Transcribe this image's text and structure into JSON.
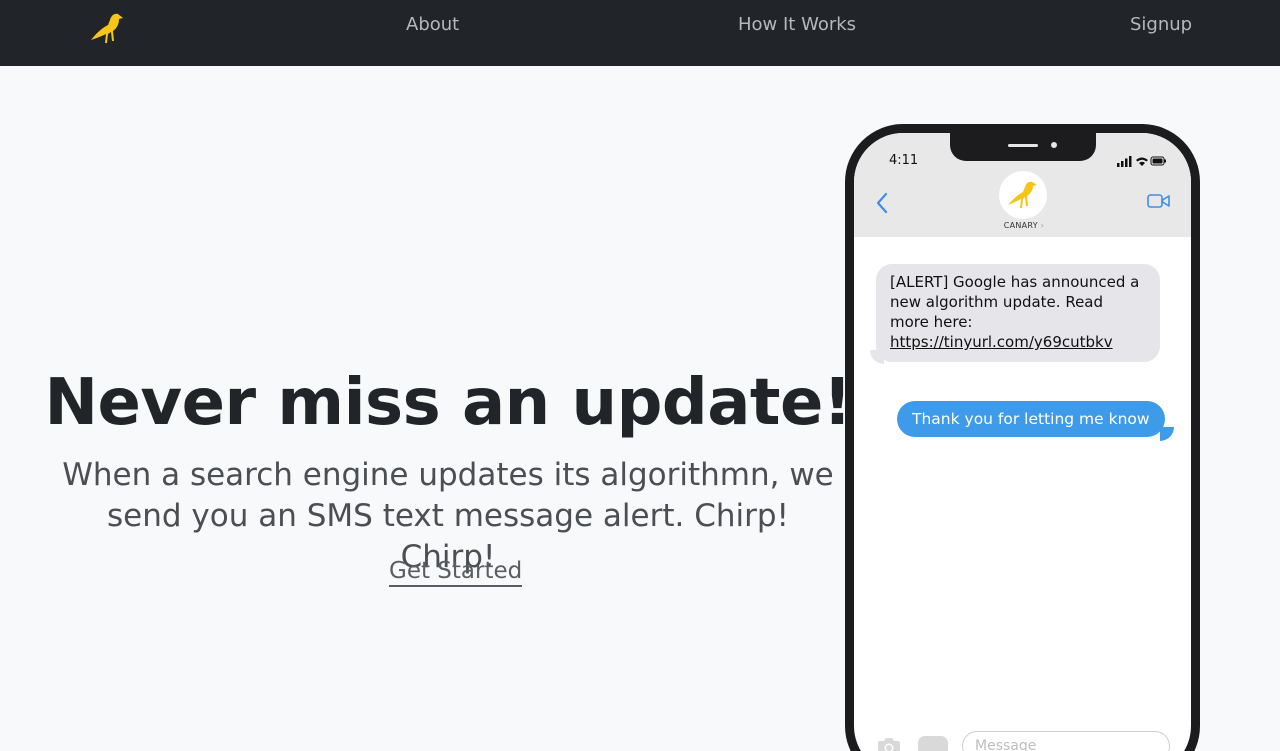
{
  "nav": {
    "logo_icon": "canary-bird-icon",
    "about": "About",
    "how_it_works": "How It Works",
    "signup": "Signup"
  },
  "hero": {
    "title": "Never miss an update!",
    "subtitle_line1": "When a search engine updates its algorithmn, we",
    "subtitle_line2": "send you an SMS text message alert. Chirp! Chirp!",
    "cta": "Get Started"
  },
  "phone": {
    "time": "4:11",
    "contact_name": "CANARY",
    "incoming_text": "[ALERT] Google has announced a new algorithm update. Read more here:",
    "incoming_link": "https://tinyurl.com/y69cutbkv",
    "outgoing_text": "Thank you for letting me know",
    "message_placeholder": "Message"
  },
  "colors": {
    "nav_bg": "#212529",
    "page_bg": "#f8f9fa",
    "brand_yellow": "#f5c518",
    "bubble_out": "#3d9be9",
    "bubble_in": "#e5e5ea"
  }
}
